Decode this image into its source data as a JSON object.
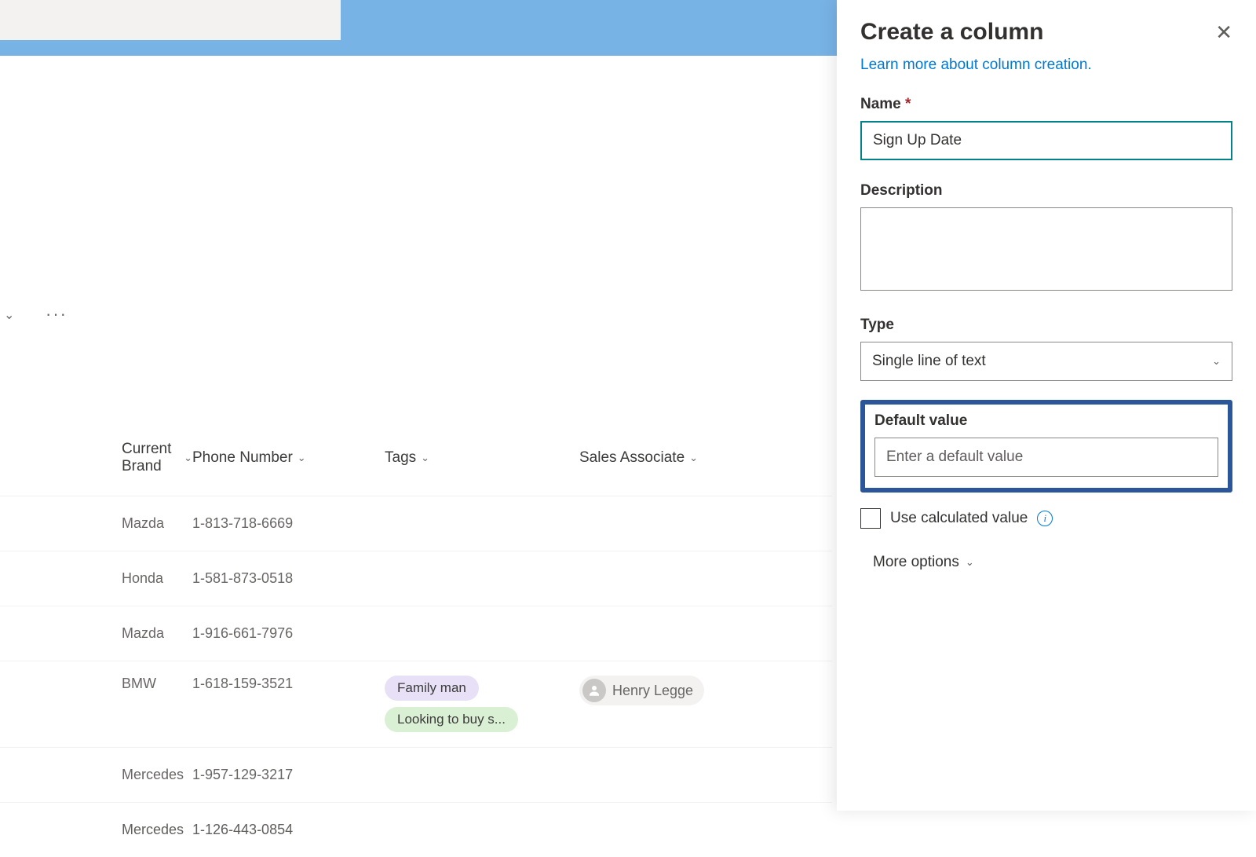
{
  "panel": {
    "title": "Create a column",
    "learn_link": "Learn more about column creation.",
    "name_label": "Name",
    "name_value": "Sign Up Date",
    "desc_label": "Description",
    "desc_value": "",
    "type_label": "Type",
    "type_value": "Single line of text",
    "default_label": "Default value",
    "default_placeholder": "Enter a default value",
    "calc_label": "Use calculated value",
    "more_label": "More options"
  },
  "columns": {
    "brand": "Current Brand",
    "phone": "Phone Number",
    "tags": "Tags",
    "assoc": "Sales Associate"
  },
  "rows": [
    {
      "brand": "Mazda",
      "phone": "1-813-718-6669",
      "tags": [],
      "assoc": ""
    },
    {
      "brand": "Honda",
      "phone": "1-581-873-0518",
      "tags": [],
      "assoc": ""
    },
    {
      "brand": "Mazda",
      "phone": "1-916-661-7976",
      "tags": [],
      "assoc": ""
    },
    {
      "brand": "BMW",
      "phone": "1-618-159-3521",
      "tags": [
        {
          "text": "Family man",
          "c": "purple"
        },
        {
          "text": "Looking to buy s...",
          "c": "green"
        }
      ],
      "assoc": "Henry Legge"
    },
    {
      "brand": "Mercedes",
      "phone": "1-957-129-3217",
      "tags": [],
      "assoc": ""
    },
    {
      "brand": "Mercedes",
      "phone": "1-126-443-0854",
      "tags": [],
      "assoc": ""
    }
  ]
}
